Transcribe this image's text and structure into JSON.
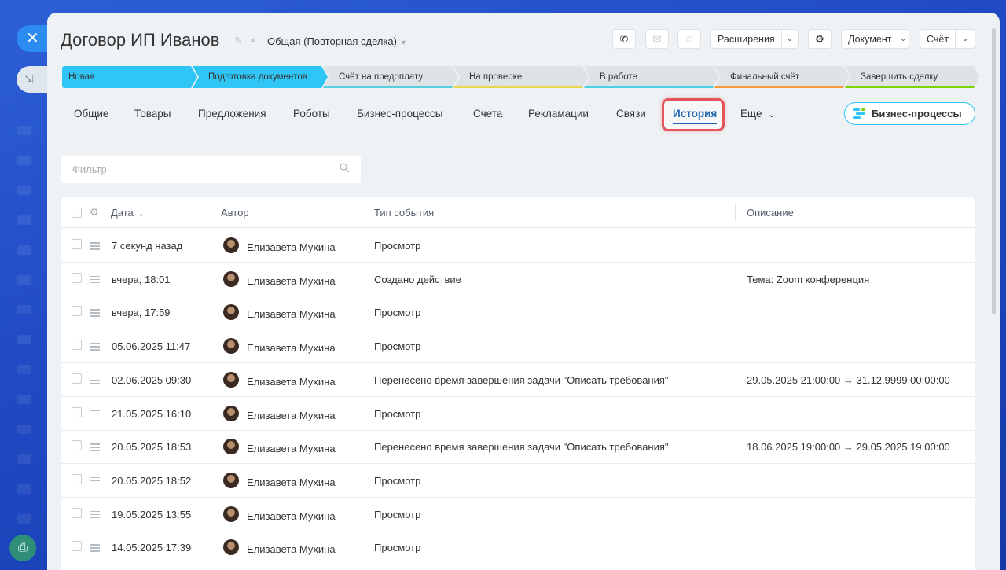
{
  "window": {
    "title": "Договор ИП Иванов",
    "category": "Общая (Повторная сделка)"
  },
  "header_buttons": {
    "extensions": "Расширения",
    "document": "Документ",
    "invoice": "Счёт"
  },
  "stages": [
    {
      "label": "Новая",
      "color": "#2fc6f6",
      "active": true
    },
    {
      "label": "Подготовка документов",
      "color": "#2fc6f6",
      "active": true
    },
    {
      "label": "Счёт на предоплату",
      "color": "#55d0e0",
      "active": false
    },
    {
      "label": "На проверке",
      "color": "#e9d84f",
      "active": false
    },
    {
      "label": "В работе",
      "color": "#47d1e2",
      "active": false
    },
    {
      "label": "Финальный счёт",
      "color": "#ff9a43",
      "active": false
    },
    {
      "label": "Завершить сделку",
      "color": "#7bd500",
      "active": false
    }
  ],
  "tabs": [
    {
      "label": "Общие"
    },
    {
      "label": "Товары"
    },
    {
      "label": "Предложения"
    },
    {
      "label": "Роботы"
    },
    {
      "label": "Бизнес-процессы"
    },
    {
      "label": "Счета"
    },
    {
      "label": "Рекламации"
    },
    {
      "label": "Связи"
    },
    {
      "label": "История",
      "active": true
    },
    {
      "label": "Еще"
    }
  ],
  "bp_button": "Бизнес-процессы",
  "filter": {
    "placeholder": "Фильтр"
  },
  "table": {
    "columns": {
      "date": "Дата",
      "author": "Автор",
      "event_type": "Тип события",
      "description": "Описание"
    },
    "rows": [
      {
        "date": "7 секунд назад",
        "author": "Елизавета Мухина",
        "event": "Просмотр",
        "description": ""
      },
      {
        "date": "вчера, 18:01",
        "author": "Елизавета Мухина",
        "event": "Создано действие",
        "description": "Тема: Zoom конференция"
      },
      {
        "date": "вчера, 17:59",
        "author": "Елизавета Мухина",
        "event": "Просмотр",
        "description": ""
      },
      {
        "date": "05.06.2025 11:47",
        "author": "Елизавета Мухина",
        "event": "Просмотр",
        "description": ""
      },
      {
        "date": "02.06.2025 09:30",
        "author": "Елизавета Мухина",
        "event": "Перенесено время завершения задачи \"Описать требования\"",
        "description": "29.05.2025 21:00:00 → 31.12.9999 00:00:00"
      },
      {
        "date": "21.05.2025 16:10",
        "author": "Елизавета Мухина",
        "event": "Просмотр",
        "description": ""
      },
      {
        "date": "20.05.2025 18:53",
        "author": "Елизавета Мухина",
        "event": "Перенесено время завершения задачи \"Описать требования\"",
        "description": "18.06.2025 19:00:00 → 29.05.2025 19:00:00"
      },
      {
        "date": "20.05.2025 18:52",
        "author": "Елизавета Мухина",
        "event": "Просмотр",
        "description": ""
      },
      {
        "date": "19.05.2025 13:55",
        "author": "Елизавета Мухина",
        "event": "Просмотр",
        "description": ""
      },
      {
        "date": "14.05.2025 17:39",
        "author": "Елизавета Мухина",
        "event": "Просмотр",
        "description": ""
      }
    ]
  }
}
